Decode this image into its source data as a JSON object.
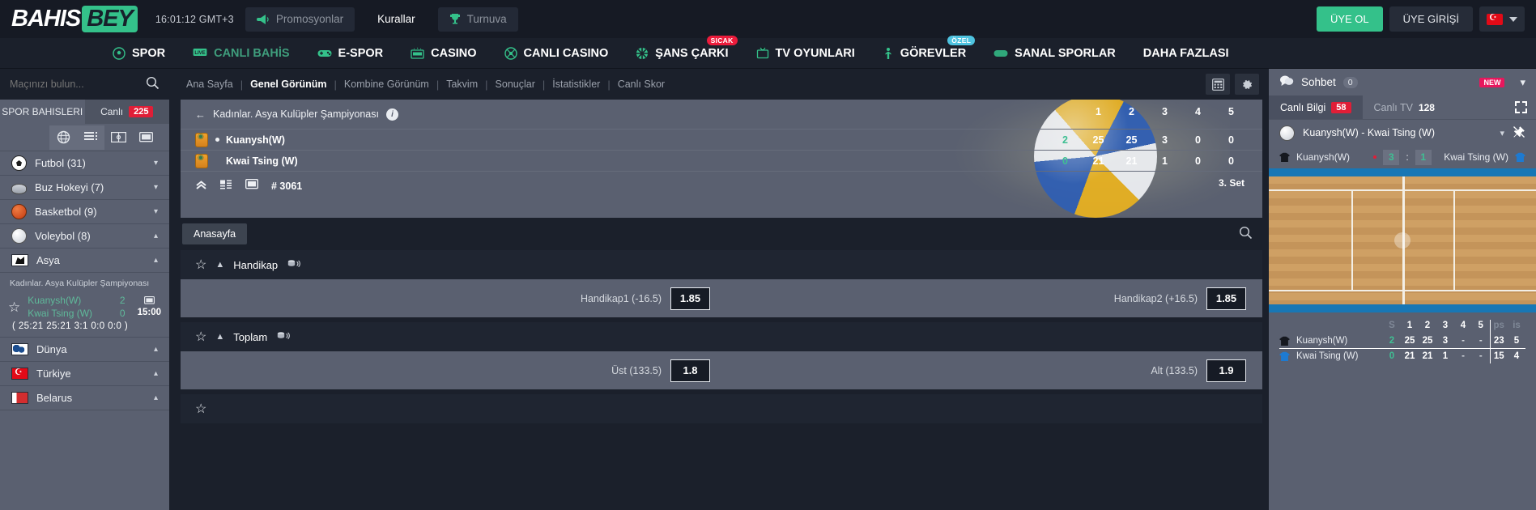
{
  "header": {
    "logo_part1": "BAHIS",
    "logo_part2": "BEY",
    "clock": "16:01:12  GMT+3",
    "promo_label": "Promosyonlar",
    "rules_label": "Kurallar",
    "tournament_label": "Turnuva",
    "signup_label": "ÜYE OL",
    "login_label": "ÜYE GİRİŞİ",
    "accent_green": "#34c18a",
    "signup_color": "#34c18a"
  },
  "nav": {
    "items": [
      {
        "label": "SPOR",
        "icon": "football-icon",
        "muted": false,
        "badge": ""
      },
      {
        "label": "CANLI BAHİS",
        "icon": "live-icon",
        "muted": true,
        "badge": ""
      },
      {
        "label": "E-SPOR",
        "icon": "gamepad-icon",
        "muted": false,
        "badge": ""
      },
      {
        "label": "CASINO",
        "icon": "slot-machine-icon",
        "muted": false,
        "badge": ""
      },
      {
        "label": "CANLI CASINO",
        "icon": "roulette-icon",
        "muted": false,
        "badge": ""
      },
      {
        "label": "ŞANS ÇARKI",
        "icon": "wheel-icon",
        "muted": false,
        "badge": "SICAK"
      },
      {
        "label": "TV OYUNLARI",
        "icon": "tv-icon",
        "muted": false,
        "badge": ""
      },
      {
        "label": "GÖREVLER",
        "icon": "trophy-person-icon",
        "muted": false,
        "badge": "ÖZEL"
      },
      {
        "label": "SANAL SPORLAR",
        "icon": "virtual-icon",
        "muted": false,
        "badge": ""
      },
      {
        "label": "DAHA FAZLASI",
        "icon": "",
        "muted": false,
        "badge": ""
      }
    ]
  },
  "sidebar": {
    "search_placeholder": "Maçınızı bulun...",
    "tab_sports": "SPOR BAHISLERI",
    "tab_live": "Canlı",
    "live_count": "225",
    "sports": [
      {
        "label": "Futbol (31)",
        "icon": "football-icon"
      },
      {
        "label": "Buz Hokeyi (7)",
        "icon": "hockey-puck-icon"
      },
      {
        "label": "Basketbol (9)",
        "icon": "basketball-icon"
      },
      {
        "label": "Voleybol (8)",
        "icon": "volleyball-icon"
      }
    ],
    "region": {
      "label": "Asya",
      "icon": "asia-flag-icon"
    },
    "league": "Kadınlar. Asya Kulüpler Şampiyonası",
    "match": {
      "team1": "Kuanysh(W)",
      "team2": "Kwai Tsing (W)",
      "score1": "2",
      "score2": "0",
      "time": "15:00",
      "sets": "( 25:21  25:21  3:1  0:0  0:0 )"
    },
    "regions": [
      {
        "label": "Dünya",
        "icon": "world-flag-icon"
      },
      {
        "label": "Türkiye",
        "icon": "turkey-flag-icon"
      },
      {
        "label": "Belarus",
        "icon": "belarus-flag-icon"
      }
    ]
  },
  "subnav": {
    "items": [
      {
        "label": "Ana Sayfa",
        "active": false
      },
      {
        "label": "Genel Görünüm",
        "active": true
      },
      {
        "label": "Kombine Görünüm",
        "active": false
      },
      {
        "label": "Takvim",
        "active": false
      },
      {
        "label": "Sonuçlar",
        "active": false
      },
      {
        "label": "İstatistikler",
        "active": false
      },
      {
        "label": "Canlı Skor",
        "active": false
      }
    ]
  },
  "scoreboard": {
    "league": "Kadınlar. Asya Kulüpler Şampiyonası",
    "set_headers": [
      "1",
      "2",
      "3",
      "4",
      "5"
    ],
    "teams": [
      {
        "name": "Kuanysh(W)",
        "sets_won": "2",
        "scores": [
          "25",
          "25",
          "3",
          "0",
          "0"
        ],
        "serving": true
      },
      {
        "name": "Kwai Tsing (W)",
        "sets_won": "0",
        "scores": [
          "21",
          "21",
          "1",
          "0",
          "0"
        ],
        "serving": false
      }
    ],
    "current_set": "3. Set",
    "match_id": "# 3061"
  },
  "markets": {
    "home_tab": "Anasayfa",
    "list": [
      {
        "title": "Handikap",
        "left_label": "Handikap1 (-16.5)",
        "left_odd": "1.85",
        "right_label": "Handikap2 (+16.5)",
        "right_odd": "1.85"
      },
      {
        "title": "Toplam",
        "left_label": "Üst (133.5)",
        "left_odd": "1.8",
        "right_label": "Alt (133.5)",
        "right_odd": "1.9"
      }
    ]
  },
  "right_panel": {
    "chat_label": "Sohbet",
    "chat_count": "0",
    "new_badge": "NEW",
    "tab_info": "Canlı Bilgi",
    "tab_info_count": "58",
    "tab_tv": "Canlı TV",
    "tab_tv_count": "128",
    "match_title": "Kuanysh(W) - Kwai Tsing (W)",
    "team1": "Kuanysh(W)",
    "team2": "Kwai Tsing (W)",
    "live_score1": "3",
    "live_score2": "1",
    "stats": {
      "headers": [
        "S",
        "1",
        "2",
        "3",
        "4",
        "5",
        "ps",
        "is"
      ],
      "rows": [
        {
          "team": "Kuanysh(W)",
          "shirt": "black",
          "sets": "2",
          "values": [
            "25",
            "25",
            "3",
            "-",
            "-"
          ],
          "ps": "23",
          "is": "5"
        },
        {
          "team": "Kwai Tsing (W)",
          "shirt": "blue",
          "sets": "0",
          "values": [
            "21",
            "21",
            "1",
            "-",
            "-"
          ],
          "ps": "15",
          "is": "4"
        }
      ]
    }
  }
}
